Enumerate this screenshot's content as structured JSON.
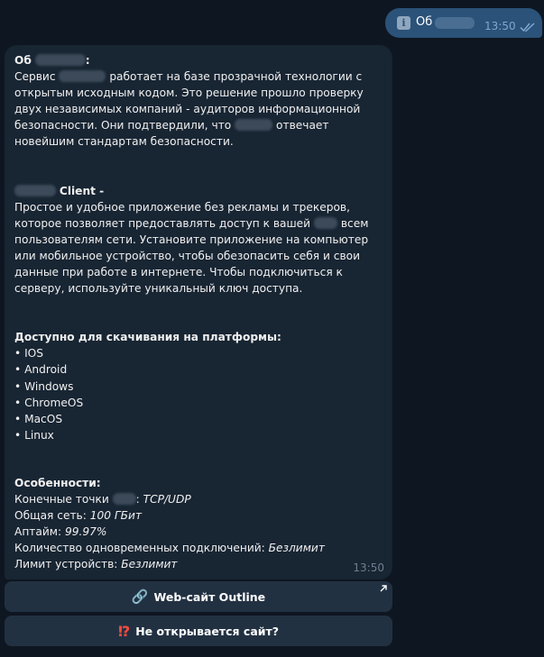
{
  "outgoing": {
    "icon": "info-icon",
    "text": "Об",
    "time": "13:50"
  },
  "message": {
    "about_title": "Об",
    "about_title_colon": ":",
    "about_p1_a": "Сервис",
    "about_p1_b": "работает на базе прозрачной технологии с открытым исходным кодом. Это решение прошло проверку двух независимых компаний - аудиторов информационной безопасности. Они подтвердили, что",
    "about_p1_c": "отвечает новейшим стандартам безопасности.",
    "client_title": "Client -",
    "client_p_a": "Простое и удобное приложение без рекламы и трекеров, которое позволяет предоставлять доступ к вашей",
    "client_p_b": "всем пользователям сети. Установите приложение на компьютер или мобильное устройство, чтобы обезопасить себя и свои данные при работе в интернете. Чтобы подключиться к серверу, используйте уникальный ключ доступа.",
    "platforms_title": "Доступно для скачивания на платформы:",
    "platforms": [
      "• IOS",
      "• Android",
      "• Windows",
      "• ChromeOS",
      "• MacOS",
      "• Linux"
    ],
    "features_title": "Особенности:",
    "f1_label": "Конечные точки",
    "f1_colon": ":",
    "f1_value": "TCP/UDP",
    "f2_label": "Общая сеть:",
    "f2_value": "100 ГБит",
    "f3_label": "Аптайм:",
    "f3_value": "99.97%",
    "f4_label": "Количество одновременных подключений:",
    "f4_value": "Безлимит",
    "f5_label": "Лимит устройств:",
    "f5_value": "Безлимит",
    "time": "13:50"
  },
  "buttons": {
    "website": {
      "icon": "link-icon",
      "label": "Web-сайт Outline"
    },
    "not_opening": {
      "icon": "exclamation-question-icon",
      "label": "Не открывается сайт?"
    }
  },
  "colors": {
    "background": "#0e1621",
    "outgoing_bubble": "#2b5278",
    "incoming_bubble": "#182533",
    "button": "#223142",
    "check_marks": "#7da8d3"
  }
}
